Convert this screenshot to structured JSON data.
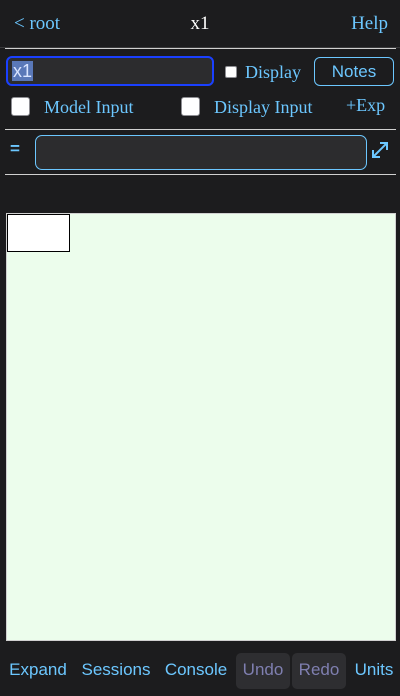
{
  "header": {
    "back_label": "< root",
    "title": "x1",
    "help_label": "Help"
  },
  "variable": {
    "name_value": "x1",
    "display_label": "Display",
    "display_checked": false,
    "notes_label": "Notes"
  },
  "options": {
    "model_input_label": "Model Input",
    "model_input_checked": false,
    "display_input_label": "Display Input",
    "display_input_checked": false,
    "exp_label": "+Exp"
  },
  "formula": {
    "equals": "=",
    "value": "",
    "expand_icon": "expand-arrows-icon"
  },
  "toolbar": {
    "expand_label": "Expand",
    "sessions_label": "Sessions",
    "console_label": "Console",
    "undo_label": "Undo",
    "redo_label": "Redo",
    "units_label": "Units"
  },
  "colors": {
    "accent": "#6cc7ff",
    "background": "#1c1c1e",
    "canvas": "#ecfdec",
    "focus_border": "#1a40ff"
  }
}
